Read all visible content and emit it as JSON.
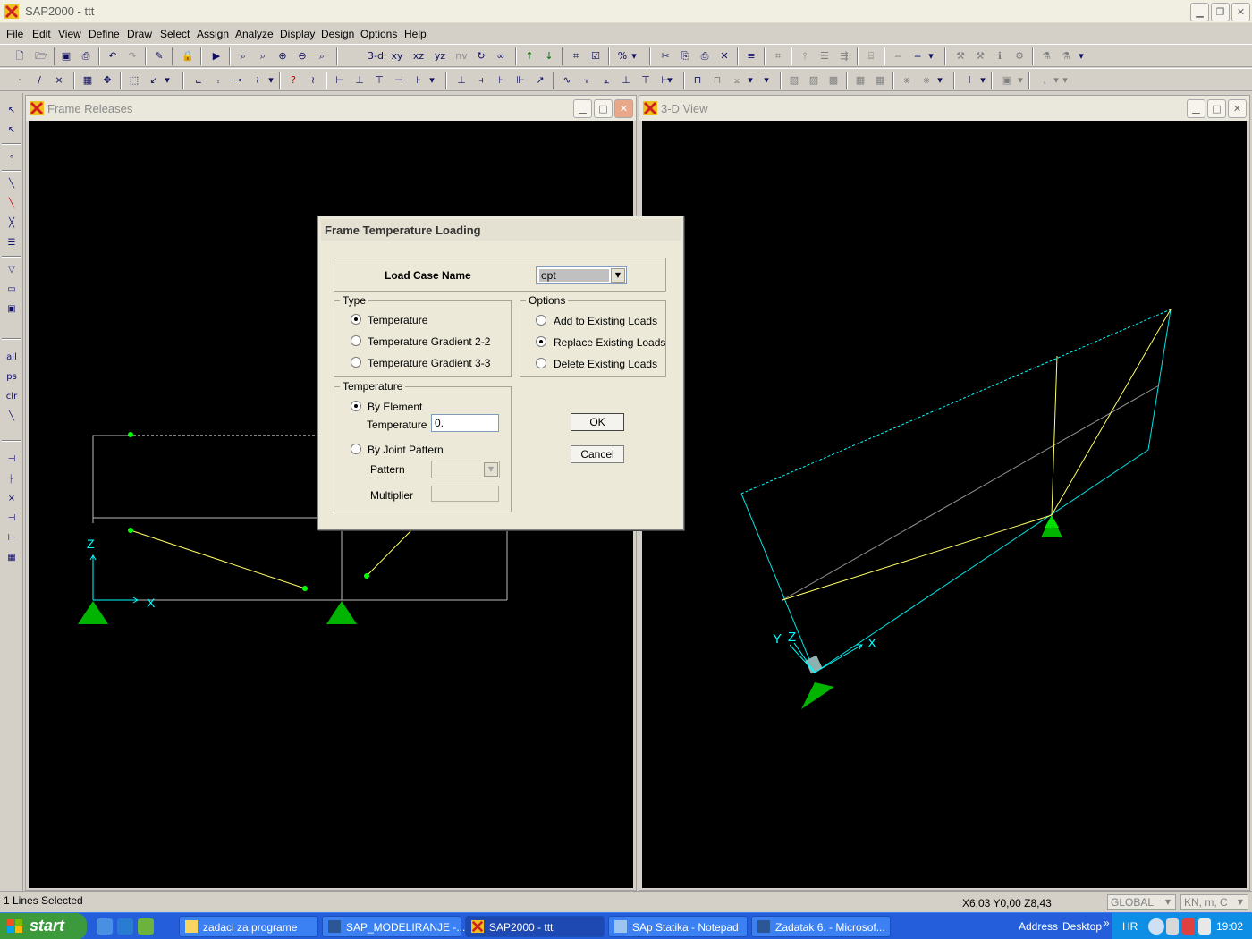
{
  "app": {
    "title": "SAP2000 - ttt"
  },
  "menu": [
    "File",
    "Edit",
    "View",
    "Define",
    "Draw",
    "Select",
    "Assign",
    "Analyze",
    "Display",
    "Design",
    "Options",
    "Help"
  ],
  "toolbar": {
    "view_3d": "3-d",
    "view_xy": "xy",
    "view_xz": "xz",
    "view_yz": "yz",
    "view_nv": "nv"
  },
  "palette": {
    "all": "all",
    "ps": "ps",
    "clr": "clr"
  },
  "views": {
    "left": {
      "title": "Frame Releases",
      "axis_z": "Z",
      "axis_x": "X"
    },
    "right": {
      "title": "3-D View",
      "axis_y": "Y",
      "axis_z": "Z",
      "axis_x": "X"
    }
  },
  "dialog": {
    "title": "Frame Temperature Loading",
    "load_case_label": "Load Case Name",
    "load_case_value": "opt",
    "type_group": "Type",
    "type_options": [
      "Temperature",
      "Temperature Gradient 2-2",
      "Temperature Gradient 3-3"
    ],
    "options_group": "Options",
    "options_options": [
      "Add to Existing Loads",
      "Replace Existing Loads",
      "Delete Existing Loads"
    ],
    "temperature_group": "Temperature",
    "by_element": "By Element",
    "temperature_label": "Temperature",
    "temperature_value": "0.",
    "by_joint_pattern": "By Joint Pattern",
    "pattern_label": "Pattern",
    "multiplier_label": "Multiplier",
    "ok": "OK",
    "cancel": "Cancel",
    "selected_type": "Temperature",
    "selected_option": "Replace Existing Loads",
    "selected_temperature_mode": "By Element"
  },
  "status": {
    "message": "1 Lines Selected",
    "coords": "X6,03  Y0,00  Z8,43",
    "coord_system": "GLOBAL",
    "units": "KN, m, C"
  },
  "taskbar": {
    "start": "start",
    "tasks": [
      "zadaci za programe",
      "SAP_MODELIRANJE -...",
      "SAP2000 - ttt",
      "SAp Statika - Notepad",
      "Zadatak 6. - Microsof..."
    ],
    "address": "Address",
    "desktop": "Desktop",
    "lang": "HR",
    "time": "19:02"
  },
  "colors": {
    "frame_line": "#ffff66",
    "selected_line": "#ffffff",
    "support": "#00b400",
    "joint": "#00ff00",
    "axis": "#00ffff",
    "edge": "#00e5e5"
  }
}
